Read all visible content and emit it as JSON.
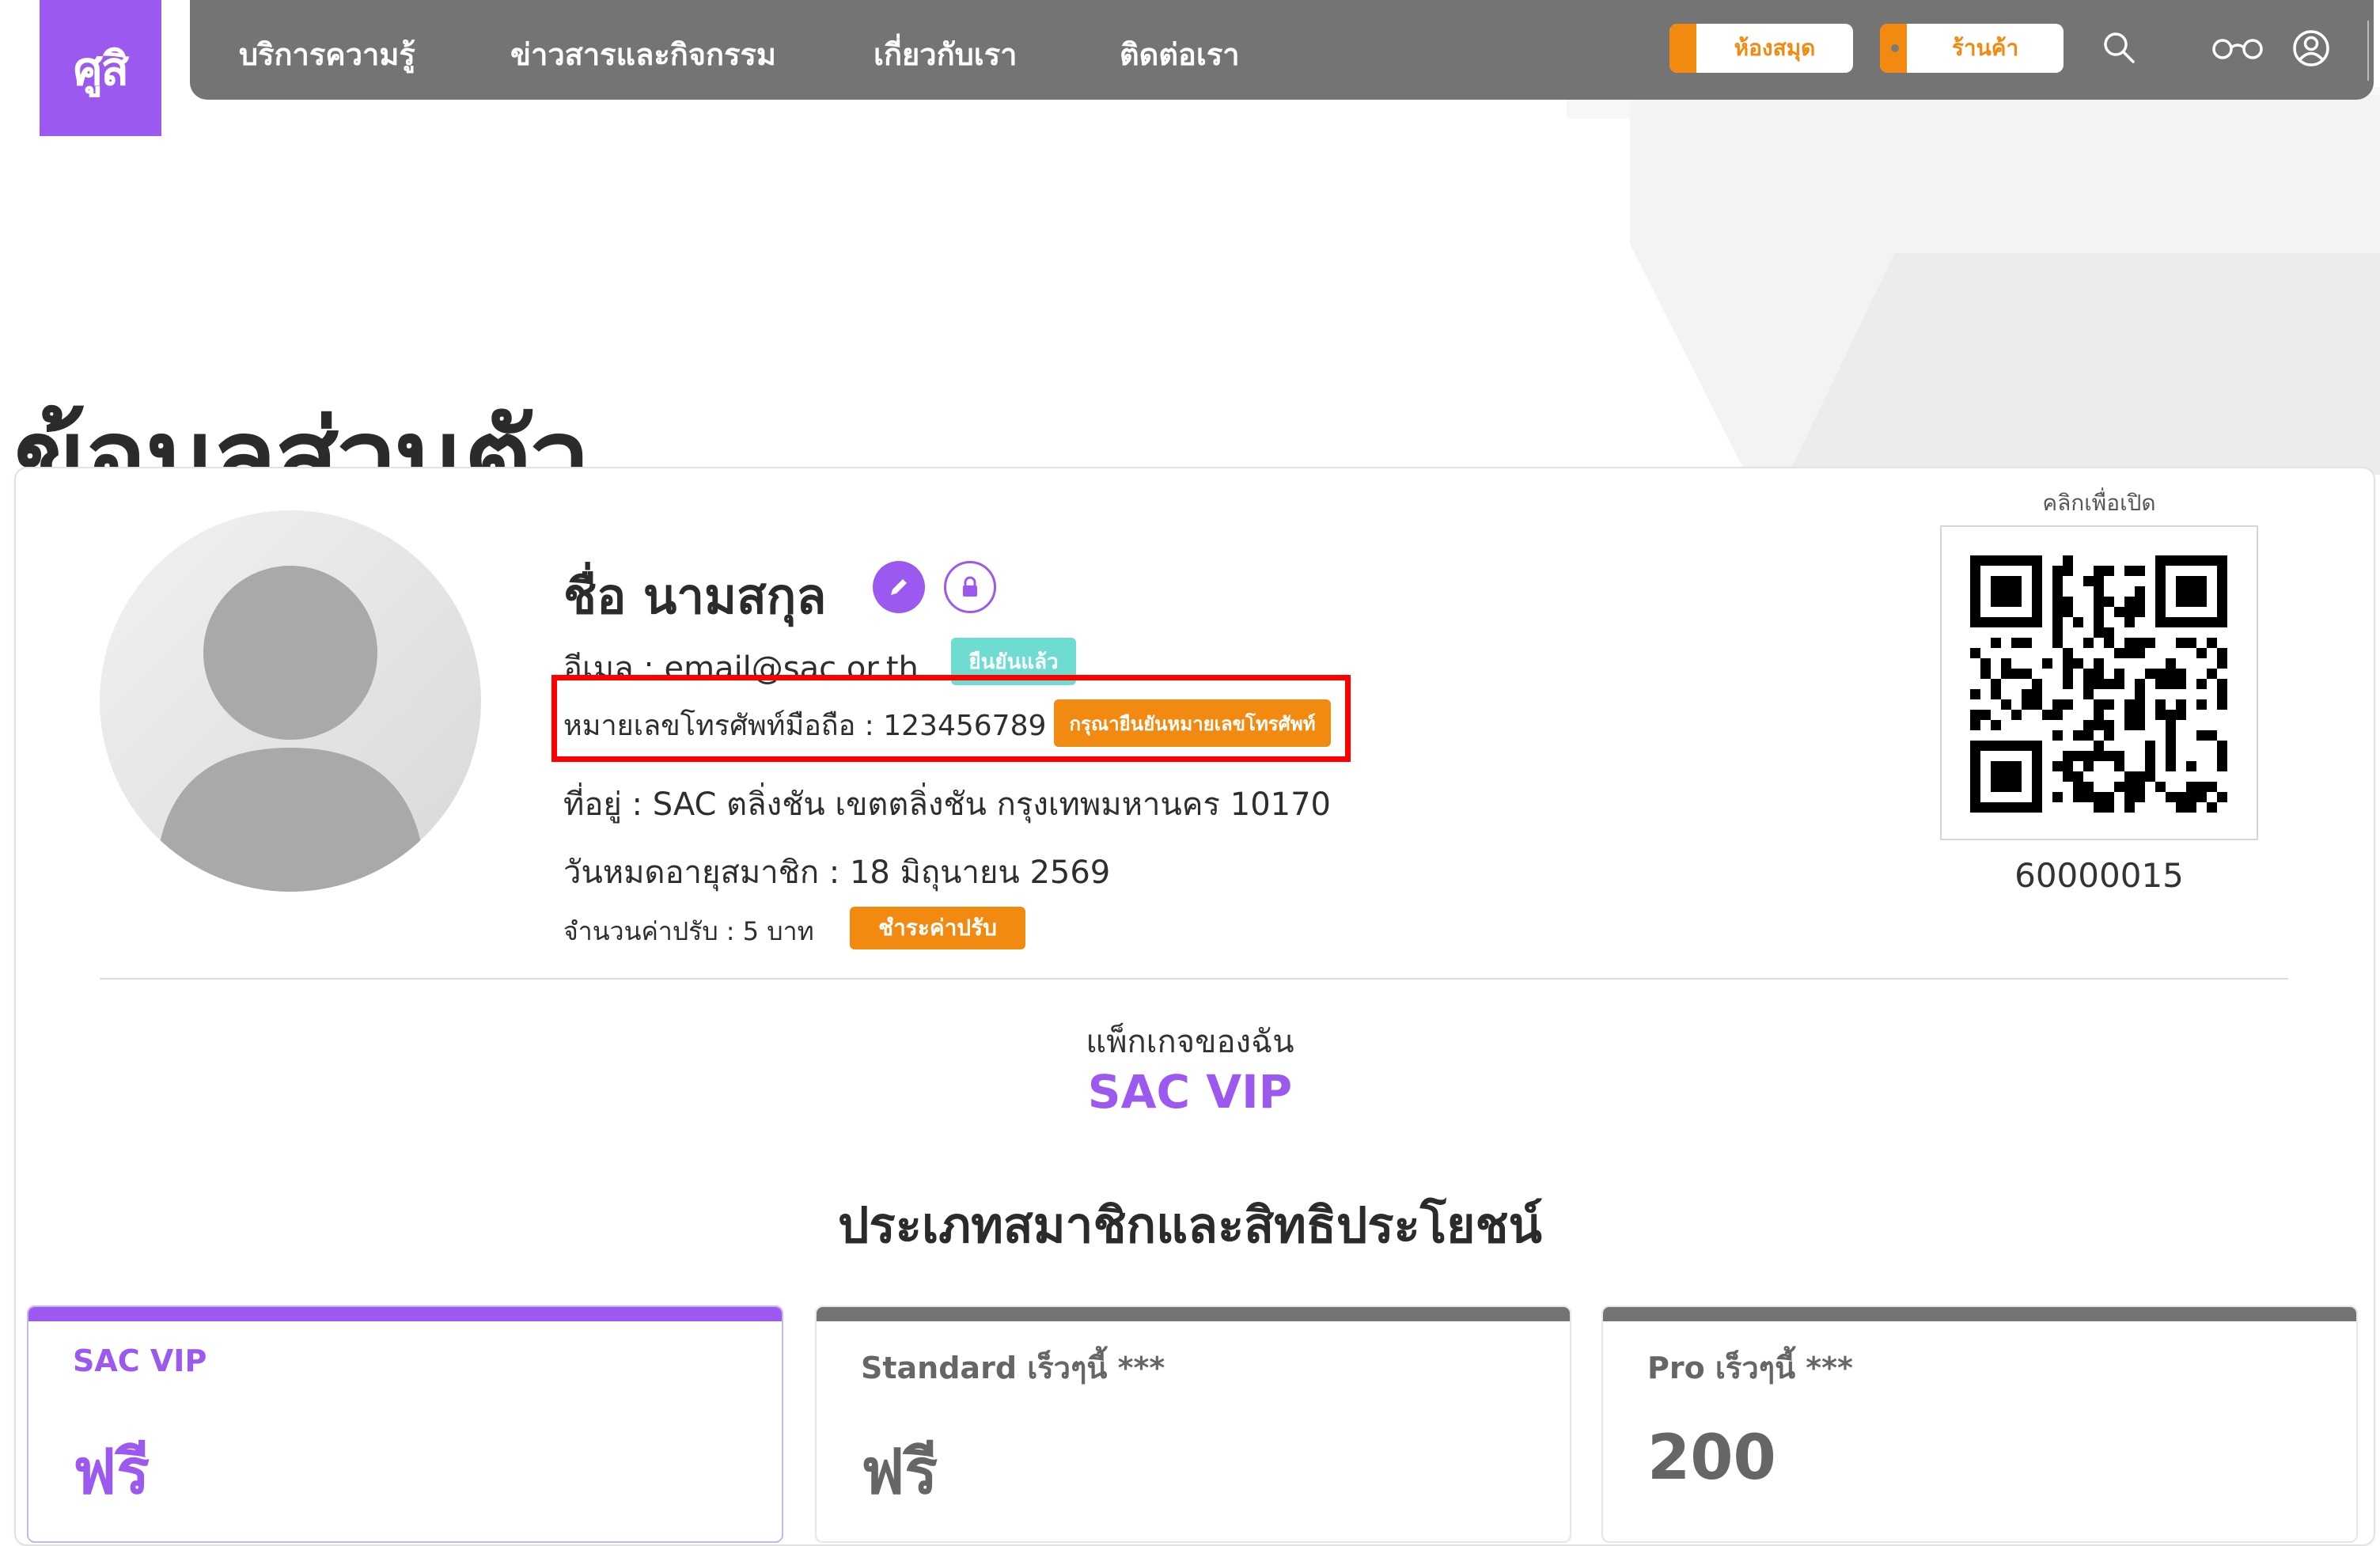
{
  "brand": {
    "logo_text": "ศูสิ",
    "accent": "#9b59f0",
    "orange": "#f28a12",
    "nav_bg": "#747474"
  },
  "nav": {
    "links": [
      "บริการความรู้",
      "ข่าวสารและกิจกรรม",
      "เกี่ยวกับเรา",
      "ติดต่อเรา"
    ],
    "library_button": "ห้องสมุด",
    "shop_button": "ร้านค้า",
    "icons": [
      "search-icon",
      "glasses-icon",
      "user-account-icon"
    ]
  },
  "page_title": "ข้อมูลส่วนตัว",
  "profile": {
    "name": "ชื่อ นามสกุล",
    "email_line": "อีเมล : email@sac.or.th",
    "email_status": "ยืนยันแล้ว",
    "phone_line": "หมายเลขโทรศัพท์มือถือ : 123456789",
    "phone_action": "กรุณายืนยันหมายเลขโทรศัพท์",
    "address_line": "ที่อยู่ : SAC ตลิ่งชัน เขตตลิ่งชัน กรุงเทพมหานคร 10170",
    "expiry_line": "วันหมดอายุสมาชิก : 18 มิถุนายน 2569",
    "fine_line": "จำนวนค่าปรับ : 5 บาท",
    "fine_action": "ชำระค่าปรับ"
  },
  "qr": {
    "caption": "คลิกเพื่อเปิด",
    "member_number": "60000015"
  },
  "package": {
    "label": "แพ็กเกจของฉัน",
    "name": "SAC VIP"
  },
  "benefits": {
    "title": "ประเภทสมาชิกและสิทธิประโยชน์",
    "plans": [
      {
        "name": "SAC VIP",
        "price": "ฟรี",
        "active": true
      },
      {
        "name": "Standard เร็วๆนี้ ***",
        "price": "ฟรี",
        "active": false
      },
      {
        "name": "Pro เร็วๆนี้ ***",
        "price": "200",
        "active": false
      }
    ]
  }
}
